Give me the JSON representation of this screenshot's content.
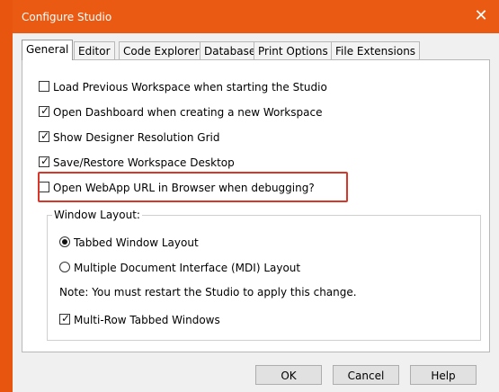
{
  "window": {
    "title": "Configure Studio",
    "close_glyph": "✕"
  },
  "tabs": [
    {
      "label": "General",
      "active": true
    },
    {
      "label": "Editor",
      "active": false
    },
    {
      "label": "Code Explorer",
      "active": false
    },
    {
      "label": "Database",
      "active": false
    },
    {
      "label": "Print Options",
      "active": false
    },
    {
      "label": "File Extensions",
      "active": false
    }
  ],
  "general": {
    "checkboxes": [
      {
        "label": "Load Previous Workspace when starting the Studio",
        "checked": false
      },
      {
        "label": "Open Dashboard when creating a new Workspace",
        "checked": true
      },
      {
        "label": "Show Designer Resolution Grid",
        "checked": true
      },
      {
        "label": "Save/Restore Workspace Desktop",
        "checked": true
      },
      {
        "label": "Open WebApp URL in Browser when debugging?",
        "checked": false
      }
    ],
    "window_layout": {
      "title": "Window Layout:",
      "options": [
        {
          "label": "Tabbed Window Layout",
          "selected": true
        },
        {
          "label": "Multiple Document Interface (MDI) Layout",
          "selected": false
        }
      ],
      "note": "Note: You must restart the Studio to apply this change.",
      "multi_row": {
        "label": "Multi-Row Tabbed Windows",
        "checked": true
      }
    }
  },
  "buttons": {
    "ok": "OK",
    "cancel": "Cancel",
    "help": "Help"
  },
  "glyphs": {
    "check": "✓"
  },
  "colors": {
    "titlebar": "#ea5a12",
    "highlight": "#d9362a"
  }
}
